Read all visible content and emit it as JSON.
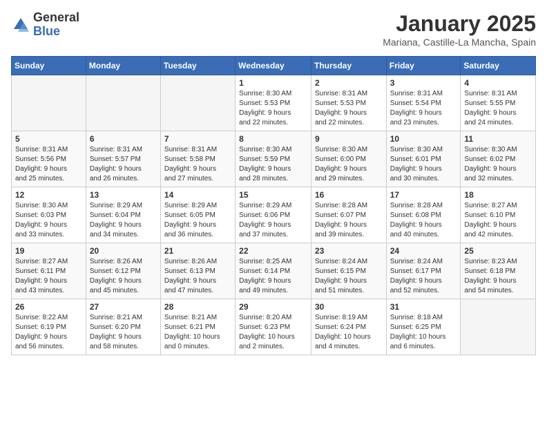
{
  "header": {
    "logo_general": "General",
    "logo_blue": "Blue",
    "month": "January 2025",
    "location": "Mariana, Castille-La Mancha, Spain"
  },
  "days_of_week": [
    "Sunday",
    "Monday",
    "Tuesday",
    "Wednesday",
    "Thursday",
    "Friday",
    "Saturday"
  ],
  "weeks": [
    [
      {
        "day": "",
        "info": ""
      },
      {
        "day": "",
        "info": ""
      },
      {
        "day": "",
        "info": ""
      },
      {
        "day": "1",
        "info": "Sunrise: 8:30 AM\nSunset: 5:53 PM\nDaylight: 9 hours\nand 22 minutes."
      },
      {
        "day": "2",
        "info": "Sunrise: 8:31 AM\nSunset: 5:53 PM\nDaylight: 9 hours\nand 22 minutes."
      },
      {
        "day": "3",
        "info": "Sunrise: 8:31 AM\nSunset: 5:54 PM\nDaylight: 9 hours\nand 23 minutes."
      },
      {
        "day": "4",
        "info": "Sunrise: 8:31 AM\nSunset: 5:55 PM\nDaylight: 9 hours\nand 24 minutes."
      }
    ],
    [
      {
        "day": "5",
        "info": "Sunrise: 8:31 AM\nSunset: 5:56 PM\nDaylight: 9 hours\nand 25 minutes."
      },
      {
        "day": "6",
        "info": "Sunrise: 8:31 AM\nSunset: 5:57 PM\nDaylight: 9 hours\nand 26 minutes."
      },
      {
        "day": "7",
        "info": "Sunrise: 8:31 AM\nSunset: 5:58 PM\nDaylight: 9 hours\nand 27 minutes."
      },
      {
        "day": "8",
        "info": "Sunrise: 8:30 AM\nSunset: 5:59 PM\nDaylight: 9 hours\nand 28 minutes."
      },
      {
        "day": "9",
        "info": "Sunrise: 8:30 AM\nSunset: 6:00 PM\nDaylight: 9 hours\nand 29 minutes."
      },
      {
        "day": "10",
        "info": "Sunrise: 8:30 AM\nSunset: 6:01 PM\nDaylight: 9 hours\nand 30 minutes."
      },
      {
        "day": "11",
        "info": "Sunrise: 8:30 AM\nSunset: 6:02 PM\nDaylight: 9 hours\nand 32 minutes."
      }
    ],
    [
      {
        "day": "12",
        "info": "Sunrise: 8:30 AM\nSunset: 6:03 PM\nDaylight: 9 hours\nand 33 minutes."
      },
      {
        "day": "13",
        "info": "Sunrise: 8:29 AM\nSunset: 6:04 PM\nDaylight: 9 hours\nand 34 minutes."
      },
      {
        "day": "14",
        "info": "Sunrise: 8:29 AM\nSunset: 6:05 PM\nDaylight: 9 hours\nand 36 minutes."
      },
      {
        "day": "15",
        "info": "Sunrise: 8:29 AM\nSunset: 6:06 PM\nDaylight: 9 hours\nand 37 minutes."
      },
      {
        "day": "16",
        "info": "Sunrise: 8:28 AM\nSunset: 6:07 PM\nDaylight: 9 hours\nand 39 minutes."
      },
      {
        "day": "17",
        "info": "Sunrise: 8:28 AM\nSunset: 6:08 PM\nDaylight: 9 hours\nand 40 minutes."
      },
      {
        "day": "18",
        "info": "Sunrise: 8:27 AM\nSunset: 6:10 PM\nDaylight: 9 hours\nand 42 minutes."
      }
    ],
    [
      {
        "day": "19",
        "info": "Sunrise: 8:27 AM\nSunset: 6:11 PM\nDaylight: 9 hours\nand 43 minutes."
      },
      {
        "day": "20",
        "info": "Sunrise: 8:26 AM\nSunset: 6:12 PM\nDaylight: 9 hours\nand 45 minutes."
      },
      {
        "day": "21",
        "info": "Sunrise: 8:26 AM\nSunset: 6:13 PM\nDaylight: 9 hours\nand 47 minutes."
      },
      {
        "day": "22",
        "info": "Sunrise: 8:25 AM\nSunset: 6:14 PM\nDaylight: 9 hours\nand 49 minutes."
      },
      {
        "day": "23",
        "info": "Sunrise: 8:24 AM\nSunset: 6:15 PM\nDaylight: 9 hours\nand 51 minutes."
      },
      {
        "day": "24",
        "info": "Sunrise: 8:24 AM\nSunset: 6:17 PM\nDaylight: 9 hours\nand 52 minutes."
      },
      {
        "day": "25",
        "info": "Sunrise: 8:23 AM\nSunset: 6:18 PM\nDaylight: 9 hours\nand 54 minutes."
      }
    ],
    [
      {
        "day": "26",
        "info": "Sunrise: 8:22 AM\nSunset: 6:19 PM\nDaylight: 9 hours\nand 56 minutes."
      },
      {
        "day": "27",
        "info": "Sunrise: 8:21 AM\nSunset: 6:20 PM\nDaylight: 9 hours\nand 58 minutes."
      },
      {
        "day": "28",
        "info": "Sunrise: 8:21 AM\nSunset: 6:21 PM\nDaylight: 10 hours\nand 0 minutes."
      },
      {
        "day": "29",
        "info": "Sunrise: 8:20 AM\nSunset: 6:23 PM\nDaylight: 10 hours\nand 2 minutes."
      },
      {
        "day": "30",
        "info": "Sunrise: 8:19 AM\nSunset: 6:24 PM\nDaylight: 10 hours\nand 4 minutes."
      },
      {
        "day": "31",
        "info": "Sunrise: 8:18 AM\nSunset: 6:25 PM\nDaylight: 10 hours\nand 6 minutes."
      },
      {
        "day": "",
        "info": ""
      }
    ]
  ]
}
